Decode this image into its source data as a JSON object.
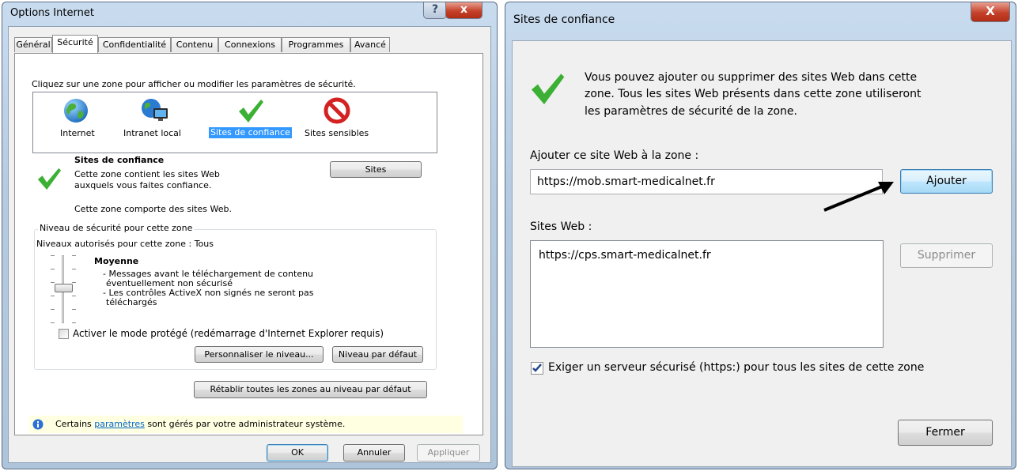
{
  "left_window": {
    "title": "Options Internet",
    "tabs": [
      "Général",
      "Sécurité",
      "Confidentialité",
      "Contenu",
      "Connexions",
      "Programmes",
      "Avancé"
    ],
    "instruction": "Cliquez sur une zone pour afficher ou modifier les paramètres de sécurité.",
    "zones": [
      {
        "label": "Internet",
        "icon": "globe-icon"
      },
      {
        "label": "Intranet local",
        "icon": "intranet-icon"
      },
      {
        "label": "Sites de confiance",
        "icon": "checkmark-icon",
        "selected": true
      },
      {
        "label": "Sites sensibles",
        "icon": "forbidden-icon"
      }
    ],
    "zone_title": "Sites de confiance",
    "zone_desc_1": "Cette zone contient les sites Web",
    "zone_desc_2": "auxquels vous faites confiance.",
    "zone_note": "Cette zone comporte des sites Web.",
    "sites_button": "Sites",
    "level_group": "Niveau de sécurité pour cette zone",
    "levels_allowed": "Niveaux autorisés pour cette zone : Tous",
    "level_name": "Moyenne",
    "level_desc_1": "- Messages avant le téléchargement de contenu",
    "level_desc_2": "éventuellement non sécurisé",
    "level_desc_3": "- Les contrôles ActiveX non signés ne seront pas",
    "level_desc_4": "téléchargés",
    "protected_mode": "Activer le mode protégé (redémarrage d'Internet Explorer requis)",
    "protected_mode_checked": false,
    "custom_level": "Personnaliser le niveau...",
    "default_level": "Niveau par défaut",
    "reset_all": "Rétablir toutes les zones au niveau par défaut",
    "admin_note_pre": "Certains",
    "admin_note_link": "paramètres",
    "admin_note_post": "sont gérés par votre administrateur système.",
    "ok": "OK",
    "cancel": "Annuler",
    "apply": "Appliquer"
  },
  "right_window": {
    "title": "Sites de confiance",
    "info_1": "Vous pouvez ajouter ou supprimer des sites Web dans cette",
    "info_2": "zone. Tous les sites Web présents dans cette zone utiliseront",
    "info_3": "les paramètres de sécurité de la zone.",
    "add_label": "Ajouter ce site Web à la zone :",
    "add_value": "https://mob.smart-medicalnet.fr",
    "add_button": "Ajouter",
    "list_label": "Sites Web :",
    "sites": [
      "https://cps.smart-medicalnet.fr"
    ],
    "remove_button": "Supprimer",
    "require_https": "Exiger un serveur sécurisé (https:) pour tous les sites de cette zone",
    "require_https_checked": true,
    "close_button": "Fermer"
  },
  "colors": {
    "accent": "#3399ff",
    "link": "#0066cc",
    "check_green": "#3cb034",
    "forbidden_red": "#d42222",
    "info_bar": "#ffffe1"
  }
}
